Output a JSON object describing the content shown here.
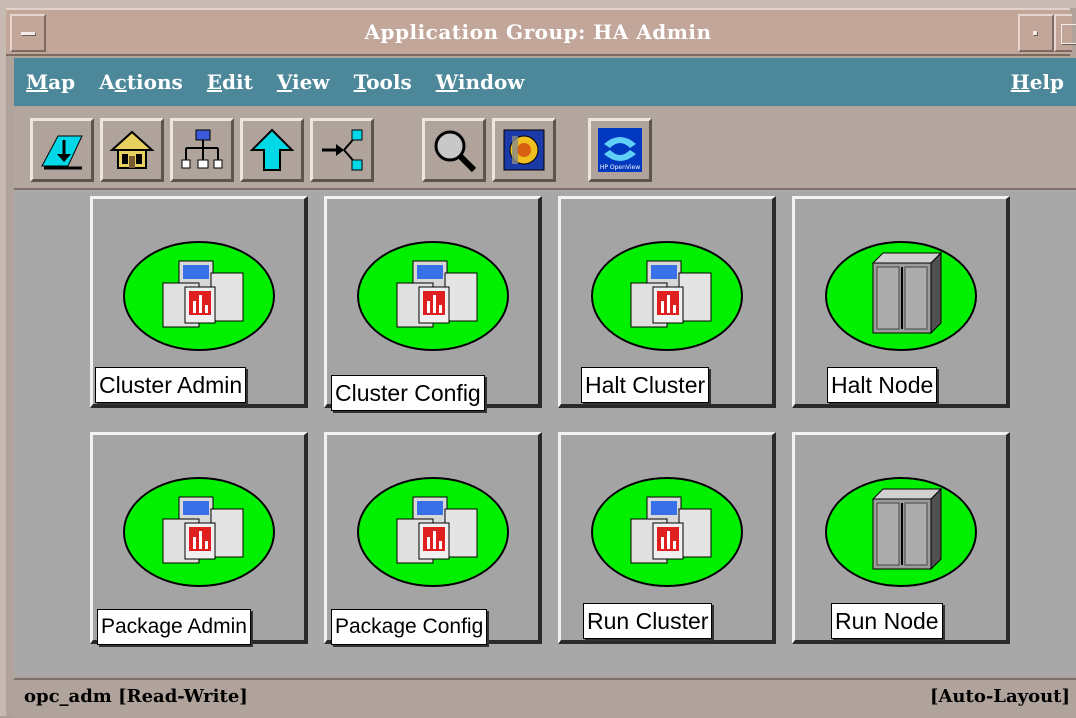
{
  "window": {
    "title": "Application Group: HA Admin"
  },
  "menubar": {
    "items": [
      {
        "mnemonic": "M",
        "rest": "ap"
      },
      {
        "pre": "A",
        "mnemonic": "c",
        "rest": "tions"
      },
      {
        "mnemonic": "E",
        "rest": "dit"
      },
      {
        "mnemonic": "V",
        "rest": "iew"
      },
      {
        "mnemonic": "T",
        "rest": "ools"
      },
      {
        "mnemonic": "W",
        "rest": "indow"
      }
    ],
    "help": {
      "mnemonic": "H",
      "rest": "elp"
    }
  },
  "toolbar": {
    "buttons": [
      {
        "icon": "drill-down-icon"
      },
      {
        "icon": "home-icon"
      },
      {
        "icon": "hierarchy-icon"
      },
      {
        "icon": "up-arrow-icon"
      },
      {
        "icon": "network-path-icon"
      },
      {
        "icon": "magnifier-icon"
      },
      {
        "icon": "console-icon"
      },
      {
        "icon": "hp-openview-icon",
        "text": "HP OpenView"
      }
    ]
  },
  "applications": [
    {
      "label": "Cluster Admin",
      "icon": "application-documents-icon"
    },
    {
      "label": "Cluster Config",
      "icon": "application-documents-icon"
    },
    {
      "label": "Halt Cluster",
      "icon": "application-documents-icon"
    },
    {
      "label": "Halt Node",
      "icon": "server-cabinet-icon"
    },
    {
      "label": "Package Admin",
      "icon": "application-documents-icon"
    },
    {
      "label": "Package Config",
      "icon": "application-documents-icon"
    },
    {
      "label": "Run Cluster",
      "icon": "application-documents-icon"
    },
    {
      "label": "Run Node",
      "icon": "server-cabinet-icon"
    }
  ],
  "status": {
    "left": "opc_adm [Read-Write]",
    "right": "[Auto-Layout]"
  },
  "colors": {
    "menubar": "#4c889a",
    "titlebar": "#c2a69a",
    "status_ok": "#00f000"
  }
}
